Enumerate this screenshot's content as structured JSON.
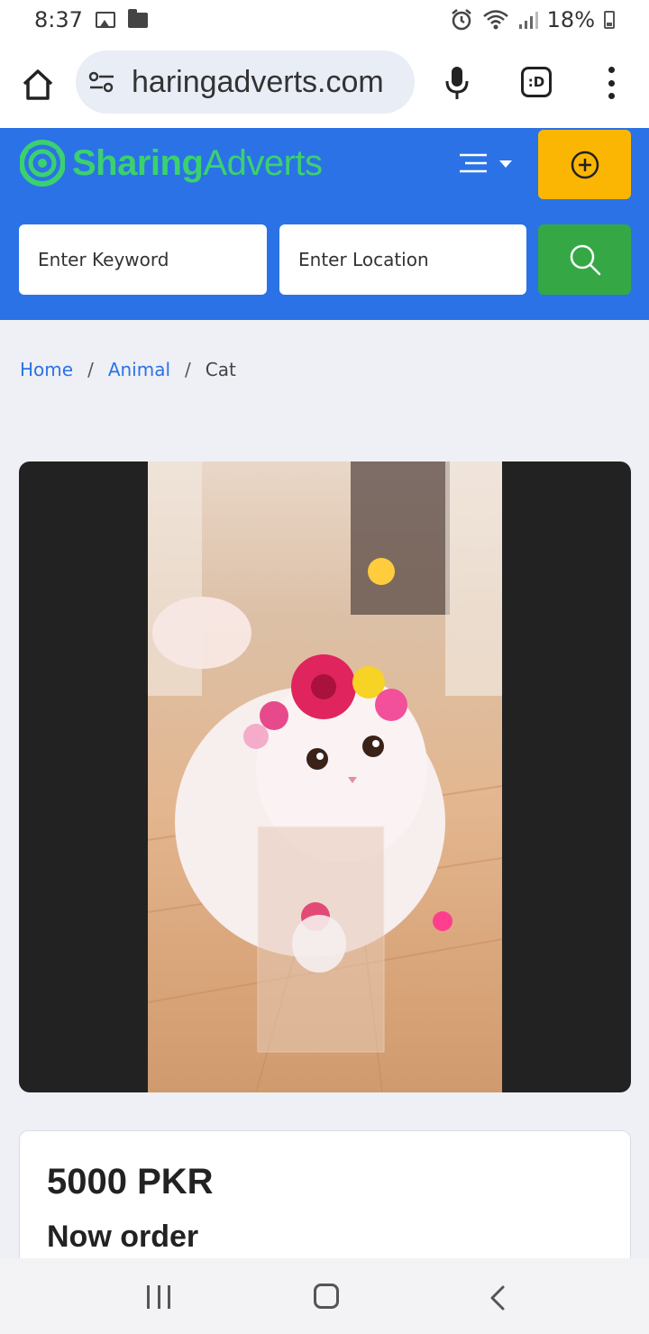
{
  "status_bar": {
    "time": "8:37",
    "battery": "18%",
    "icons": [
      "image-icon",
      "folder-icon",
      "alarm-icon",
      "wifi-icon",
      "signal-icon",
      "battery-icon"
    ]
  },
  "browser": {
    "url": "haringadverts.com",
    "tab_switcher_label": ":D",
    "icons": [
      "home-icon",
      "site-settings-icon",
      "mic-icon",
      "tab-switcher-icon",
      "more-vert-icon"
    ]
  },
  "site": {
    "logo_text_bold": "Sharing",
    "logo_text_light": "Adverts",
    "brand_color": "#2b72e6",
    "logo_color": "#3bd16f",
    "post_button_color": "#fbb604",
    "search_button_color": "#35a845",
    "search": {
      "keyword_placeholder": "Enter Keyword",
      "location_placeholder": "Enter Location"
    }
  },
  "breadcrumb": {
    "items": [
      "Home",
      "Animal",
      "Cat"
    ],
    "separator": "/"
  },
  "listing": {
    "image_subject": "white fluffy cat wearing a pink flower crown",
    "price": "5000 PKR",
    "action_text": "Now order"
  },
  "nav_bar": {
    "icons": [
      "recent-apps-icon",
      "home-circle-icon",
      "back-icon"
    ]
  }
}
